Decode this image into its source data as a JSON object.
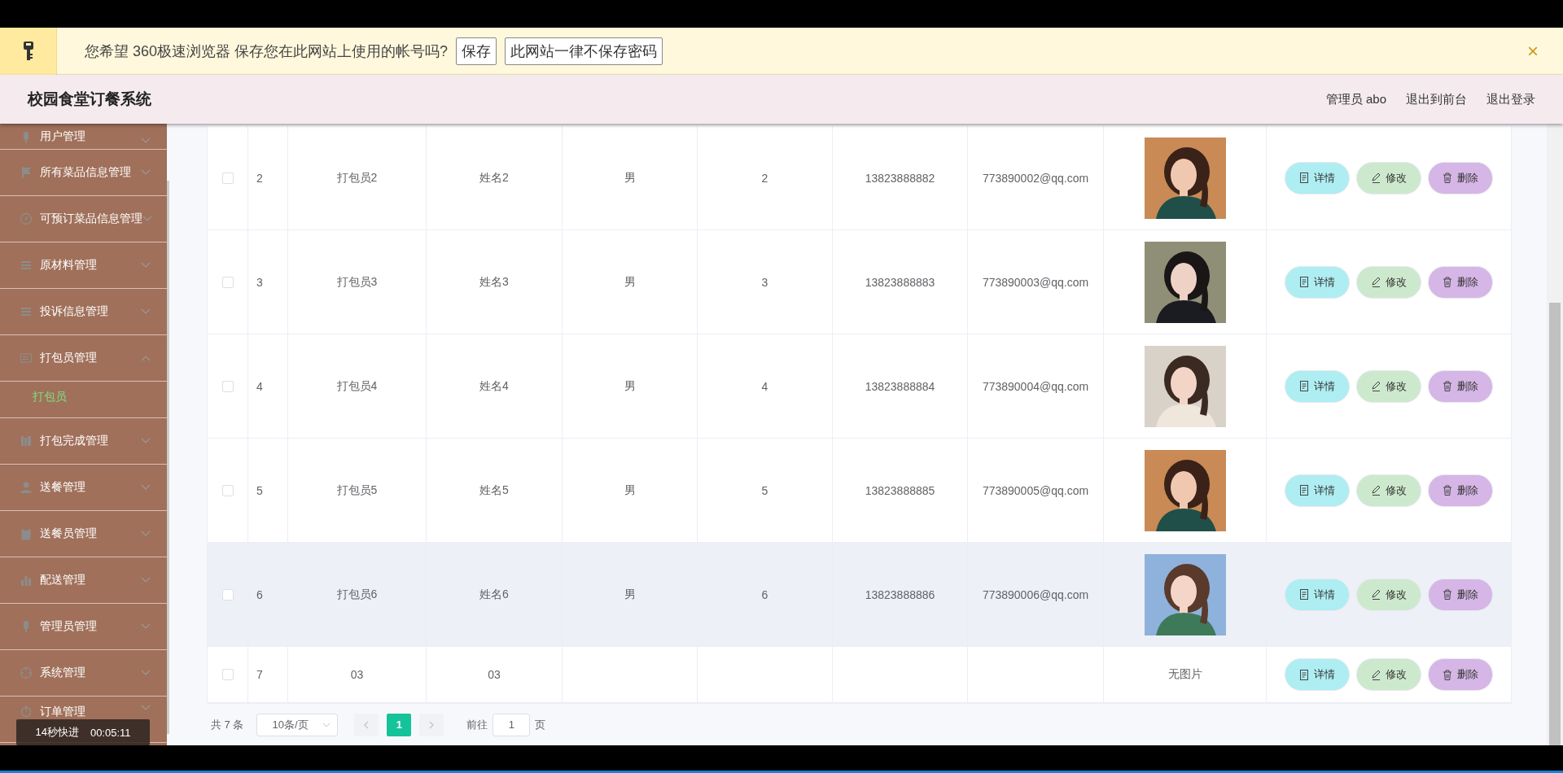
{
  "password_prompt": {
    "message": "您希望 360极速浏览器 保存您在此网站上使用的帐号吗?",
    "buttons": [
      "保存",
      "此网站一律不保存密码"
    ],
    "close": "×"
  },
  "header": {
    "title": "校园食堂订餐系统",
    "links": [
      "管理员 abo",
      "退出到前台",
      "退出登录"
    ]
  },
  "sidebar": {
    "items": [
      {
        "label": "用户管理",
        "expanded": false
      },
      {
        "label": "所有菜品信息管理",
        "expanded": false
      },
      {
        "label": "可预订菜品信息管理",
        "expanded": false
      },
      {
        "label": "原材料管理",
        "expanded": false
      },
      {
        "label": "投诉信息管理",
        "expanded": false
      },
      {
        "label": "打包员管理",
        "expanded": true,
        "children": [
          {
            "label": "打包员",
            "selected": true
          }
        ]
      },
      {
        "label": "打包完成管理",
        "expanded": false
      },
      {
        "label": "送餐管理",
        "expanded": false
      },
      {
        "label": "送餐员管理",
        "expanded": false
      },
      {
        "label": "配送管理",
        "expanded": false
      },
      {
        "label": "管理员管理",
        "expanded": false
      },
      {
        "label": "系统管理",
        "expanded": false
      },
      {
        "label": "订单管理",
        "expanded": false
      }
    ]
  },
  "table": {
    "rows": [
      {
        "checked": false,
        "highlighted": false,
        "cells": [
          "2",
          "打包员2",
          "姓名2",
          "男",
          "2",
          "13823888882",
          "773890002@qq.com"
        ],
        "actions": [
          "详情",
          "修改",
          "删除"
        ]
      },
      {
        "checked": false,
        "highlighted": false,
        "cells": [
          "3",
          "打包员3",
          "姓名3",
          "男",
          "3",
          "13823888883",
          "773890003@qq.com"
        ],
        "actions": [
          "详情",
          "修改",
          "删除"
        ]
      },
      {
        "checked": false,
        "highlighted": false,
        "cells": [
          "4",
          "打包员4",
          "姓名4",
          "男",
          "4",
          "13823888884",
          "773890004@qq.com"
        ],
        "actions": [
          "详情",
          "修改",
          "删除"
        ]
      },
      {
        "checked": false,
        "highlighted": false,
        "cells": [
          "5",
          "打包员5",
          "姓名5",
          "男",
          "5",
          "13823888885",
          "773890005@qq.com"
        ],
        "actions": [
          "详情",
          "修改",
          "删除"
        ]
      },
      {
        "checked": false,
        "highlighted": true,
        "cells": [
          "6",
          "打包员6",
          "姓名6",
          "男",
          "6",
          "13823888886",
          "773890006@qq.com"
        ],
        "actions": [
          "详情",
          "修改",
          "删除"
        ]
      },
      {
        "checked": false,
        "highlighted": false,
        "cells": [
          "7",
          "03",
          "03",
          "",
          "",
          "",
          ""
        ],
        "photo": {
          "kind": "text",
          "text": "无图片"
        },
        "actions": [
          "详情",
          "修改",
          "删除"
        ]
      }
    ]
  },
  "pagination": {
    "total": "共 7 条",
    "page_size": "10条/页",
    "pages": [
      {
        "label": "1",
        "selected": true
      }
    ],
    "goto_label": "前往",
    "goto_value": "1",
    "goto_suffix": "页"
  },
  "player_overlay": {
    "speed": "14秒快进",
    "time": "00:05:11"
  }
}
